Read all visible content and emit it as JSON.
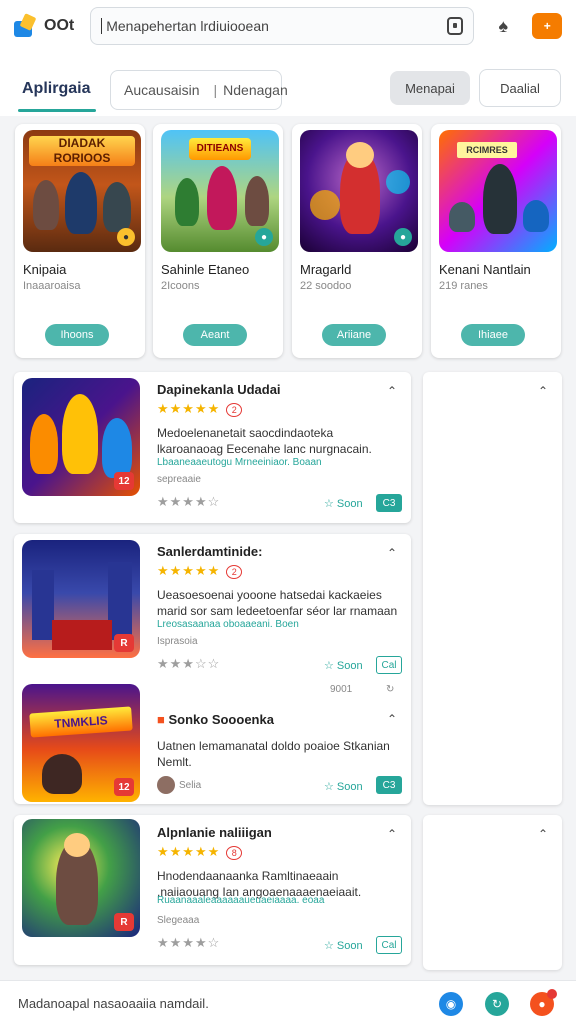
{
  "header": {
    "brand": "OOt",
    "search_value": "Menapehertan lrdiuiooean",
    "gift_label": "+"
  },
  "tabs": {
    "active": "Aplirgaia",
    "segment_left": "Aucausaisin",
    "segment_right": "Ndenagan",
    "pill_gray": "Menapai",
    "pill_white": "Daalial"
  },
  "featured": [
    {
      "title": "Knipaia",
      "sub": "Inaaaroaisa",
      "button": "Ihoons",
      "art_text": "DIADAK RORIOOS"
    },
    {
      "title": "Sahinle Etaneo",
      "sub": "2Icoons",
      "button": "Aeant",
      "art_text": "DITIEANS"
    },
    {
      "title": "Mragarld",
      "sub": "22 soodoo",
      "button": "Ariiane",
      "art_text": ""
    },
    {
      "title": "Kenani Nantlain",
      "sub": "219 ranes",
      "button": "Ihiaee",
      "art_text": "RCIMRES"
    }
  ],
  "list": [
    {
      "title": "Dapinekanla Udadai",
      "rating_num": "2",
      "desc": "Medoelenanetait saocdindaoteka lkaroanaoag Eecenahe lanc nurgnacain.",
      "link": "Lbaaneaaeutogu Mrneeiniaor. Boaan",
      "meta": "sepreaaie",
      "save": "Soon",
      "box": "C3",
      "tag": "12"
    },
    {
      "title": "Sanlerdamtinide:",
      "rating_num": "2",
      "desc": "Ueasoesoenai yooone hatsedai kackaeies marid sor sam ledeetoenfar séor lar rnamaan",
      "link": "Lreosasaanaa oboaaeani. Boen",
      "meta": "Isprasoia",
      "save": "Soon",
      "box": "Cal",
      "tag": "R",
      "extra": "9001"
    },
    {
      "title": "Sonko Soooenka",
      "desc": "Uatnen lemamanatal doldo poaioe Stkanian Nemlt.",
      "meta": "Selia",
      "save": "Soon",
      "box": "C3",
      "tag": "12",
      "art_text": "TNMKLIS"
    },
    {
      "title": "Alpnlanie naliiigan",
      "rating_num": "8",
      "desc": "Hnodendaanaanka Ramltinaeaain ,naiiaouang Ian angoaenaaaenaeiaait.",
      "link": "Ruaanaaaleaaaaaaueuaeiaaaa. eoaa",
      "meta": "Slegeaaa",
      "save": "Soon",
      "box": "Cal",
      "tag": "R"
    }
  ],
  "footer": {
    "text": "Madanoapal nasaoaaiia namdail."
  },
  "colors": {
    "accent": "#26a69a",
    "star": "#f5b400",
    "alert": "#e53935"
  }
}
